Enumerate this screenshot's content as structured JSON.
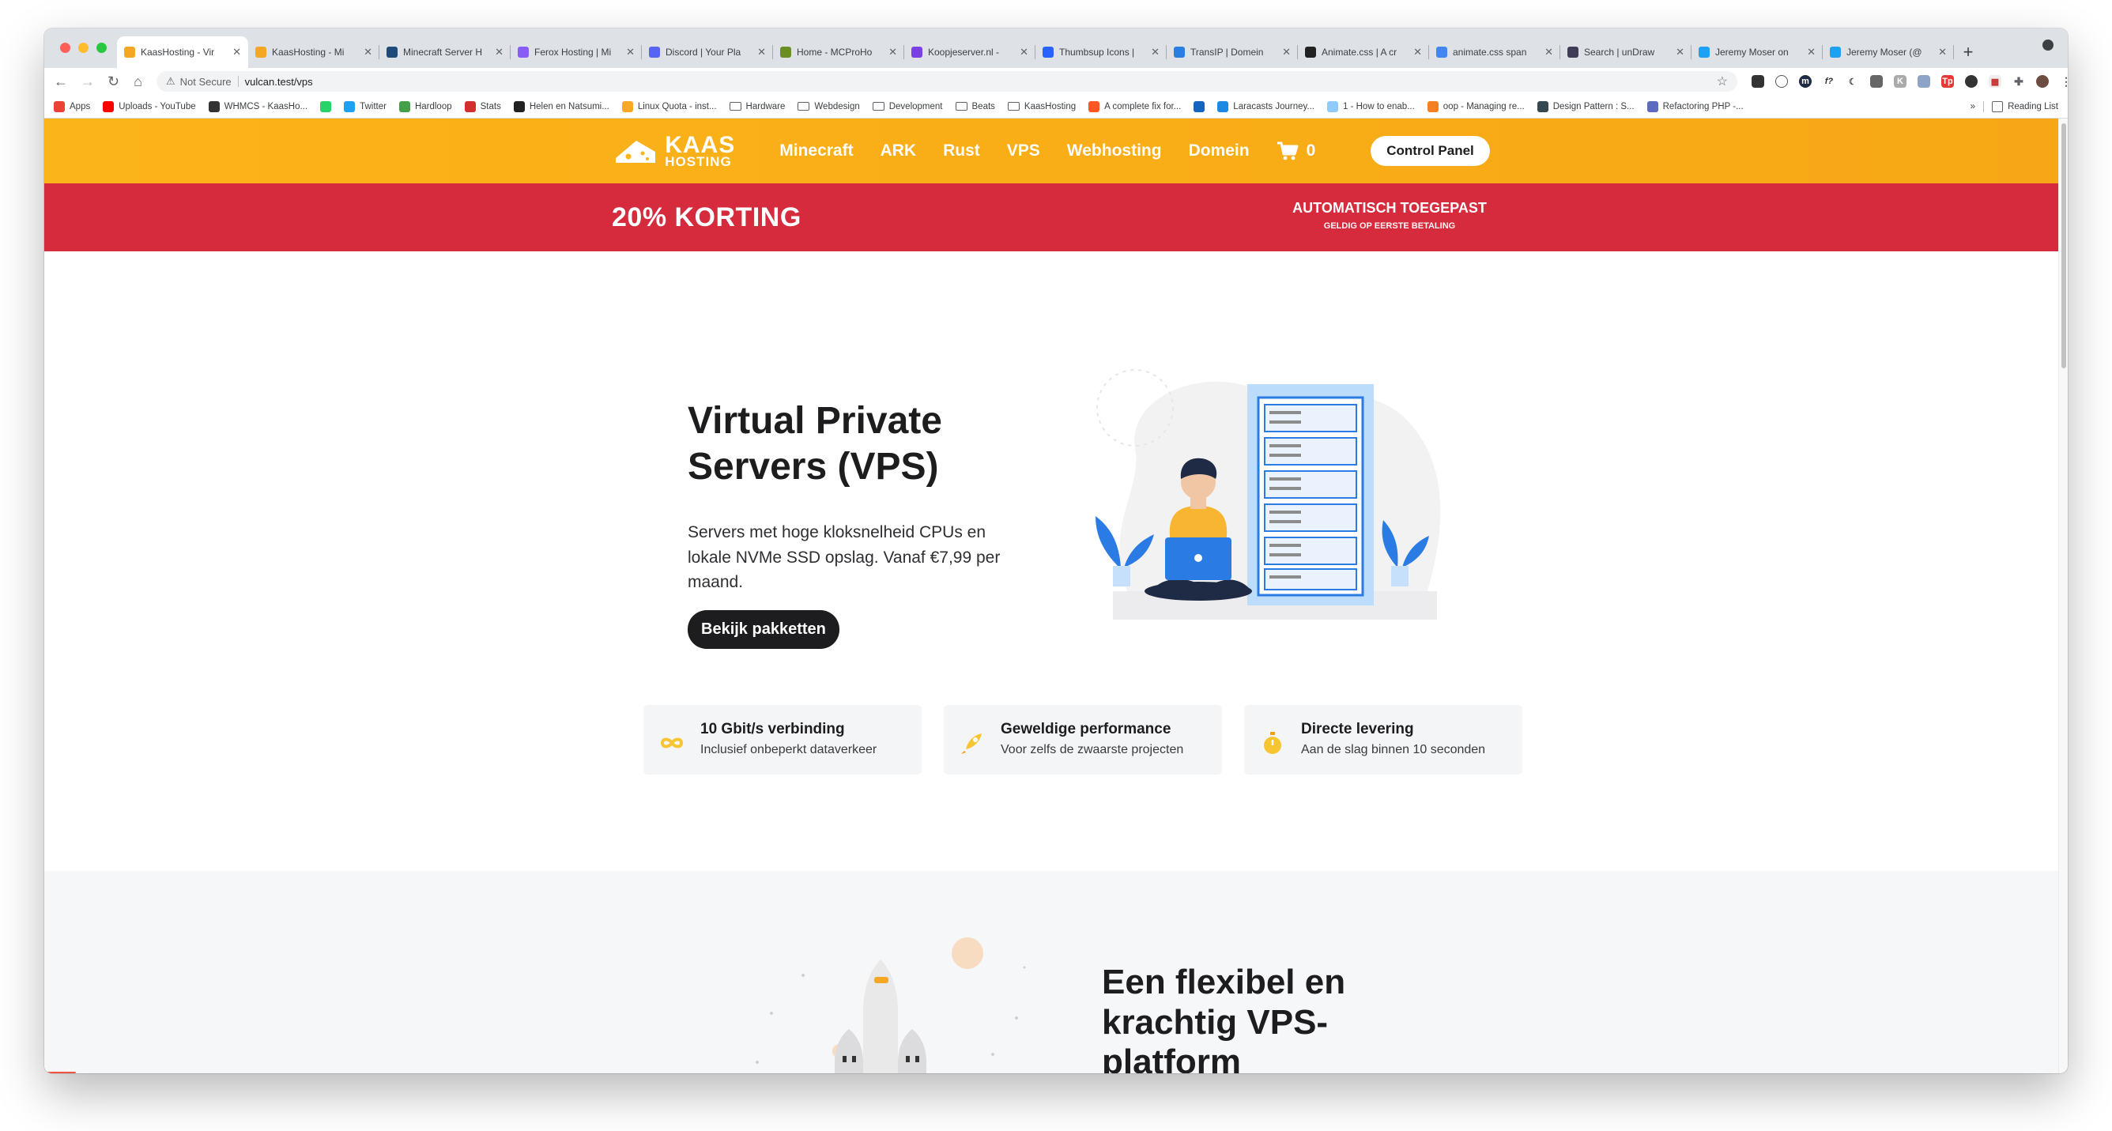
{
  "browser": {
    "tabs": [
      {
        "title": "KaasHosting - Vir",
        "active": true,
        "color": "#f5a623"
      },
      {
        "title": "KaasHosting - Mi",
        "active": false,
        "color": "#f5a623"
      },
      {
        "title": "Minecraft Server H",
        "active": false,
        "color": "#1f4b7a"
      },
      {
        "title": "Ferox Hosting | Mi",
        "active": false,
        "color": "#8a5cf6"
      },
      {
        "title": "Discord | Your Pla",
        "active": false,
        "color": "#5865f2"
      },
      {
        "title": "Home - MCProHo",
        "active": false,
        "color": "#6b8e23"
      },
      {
        "title": "Koopjeserver.nl -",
        "active": false,
        "color": "#7b3fe4"
      },
      {
        "title": "Thumbsup Icons |",
        "active": false,
        "color": "#2962ff"
      },
      {
        "title": "TransIP | Domein",
        "active": false,
        "color": "#2a7de1"
      },
      {
        "title": "Animate.css | A cr",
        "active": false,
        "color": "#222222"
      },
      {
        "title": "animate.css span",
        "active": false,
        "color": "#4285f4"
      },
      {
        "title": "Search | unDraw",
        "active": false,
        "color": "#3f3d56"
      },
      {
        "title": "Jeremy Moser on",
        "active": false,
        "color": "#1da1f2"
      },
      {
        "title": "Jeremy Moser (@",
        "active": false,
        "color": "#1da1f2"
      }
    ],
    "security_label": "Not Secure",
    "url": "vulcan.test/vps",
    "bookmarks": [
      {
        "label": "Apps",
        "color": "#ea4335"
      },
      {
        "label": "Uploads - YouTube",
        "color": "#ff0000"
      },
      {
        "label": "WHMCS - KaasHo...",
        "color": "#333333"
      },
      {
        "label": "",
        "color": "#25d366"
      },
      {
        "label": "Twitter",
        "color": "#1da1f2"
      },
      {
        "label": "Hardloop",
        "color": "#43a047"
      },
      {
        "label": "Stats",
        "color": "#d32f2f"
      },
      {
        "label": "Helen en Natsumi...",
        "color": "#222222"
      },
      {
        "label": "Linux Quota - inst...",
        "color": "#f9a825"
      },
      {
        "label": "Hardware",
        "folder": true
      },
      {
        "label": "Webdesign",
        "folder": true
      },
      {
        "label": "Development",
        "folder": true
      },
      {
        "label": "Beats",
        "folder": true
      },
      {
        "label": "KaasHosting",
        "folder": true
      },
      {
        "label": "A complete fix for...",
        "color": "#ff5722"
      },
      {
        "label": "",
        "color": "#1565c0"
      },
      {
        "label": "Laracasts Journey...",
        "color": "#1e88e5"
      },
      {
        "label": "1 - How to enab...",
        "color": "#90caf9"
      },
      {
        "label": "oop - Managing re...",
        "color": "#f48024"
      },
      {
        "label": "Design Pattern : S...",
        "color": "#37474f"
      },
      {
        "label": "Refactoring PHP -...",
        "color": "#5c6bc0"
      }
    ],
    "more_bookmarks": "»",
    "reading_list": "Reading List"
  },
  "site": {
    "brand_color": "#fbb419",
    "promo_color": "#d52b3c",
    "logo": {
      "line1": "KAAS",
      "line2": "HOSTING"
    },
    "nav": [
      "Minecraft",
      "ARK",
      "Rust",
      "VPS",
      "Webhosting",
      "Domein"
    ],
    "cart_count": "0",
    "control_panel": "Control Panel",
    "promo": {
      "discount": "20% KORTING",
      "applied": "AUTOMATISCH TOEGEPAST",
      "valid": "GELDIG OP EERSTE BETALING"
    },
    "hero": {
      "title": "Virtual Private Servers (VPS)",
      "description": "Servers met hoge kloksnelheid CPUs en lokale NVMe SSD opslag. Vanaf €7,99 per maand.",
      "button": "Bekijk pakketten"
    },
    "features": [
      {
        "title": "10 Gbit/s verbinding",
        "desc": "Inclusief onbeperkt dataverkeer",
        "icon": "infinity-icon"
      },
      {
        "title": "Geweldige performance",
        "desc": "Voor zelfs de zwaarste projecten",
        "icon": "rocket-icon"
      },
      {
        "title": "Directe levering",
        "desc": "Aan de slag binnen 10 seconden",
        "icon": "stopwatch-icon"
      }
    ],
    "section2": {
      "title": "Een flexibel en krachtig VPS-platform"
    }
  }
}
